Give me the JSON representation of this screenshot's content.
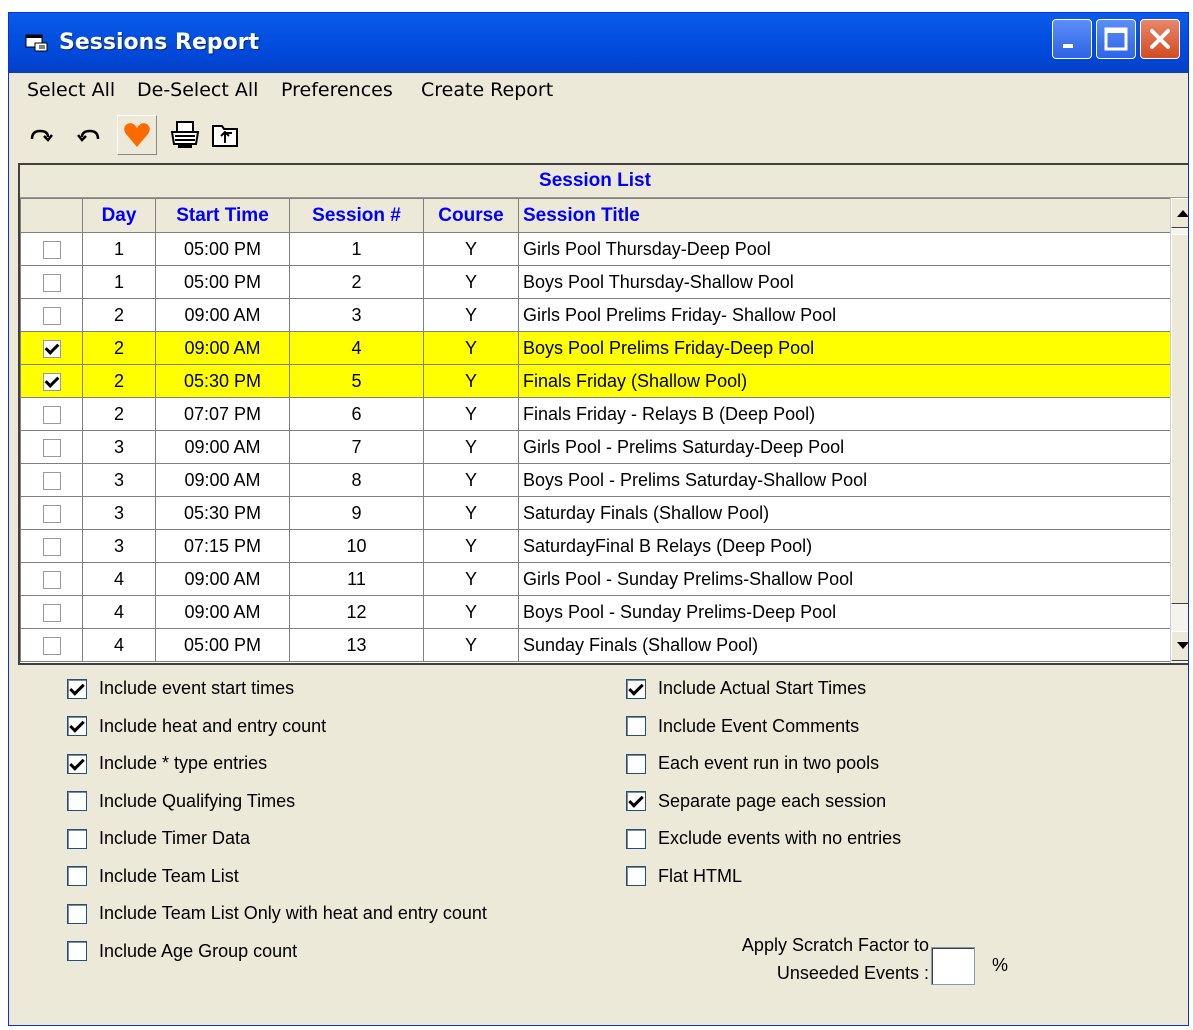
{
  "window": {
    "title": "Sessions Report",
    "title_color": "#FFFFFF",
    "titlebar_color": "#0350E0"
  },
  "menu": [
    "Select All",
    "De-Select All",
    "Preferences",
    "Create Report"
  ],
  "toolbar": {
    "icons": [
      "redo-icon",
      "undo-icon",
      "heart-icon",
      "printer-icon",
      "folder-up-icon"
    ],
    "heart_color": "#FF6A00"
  },
  "grid": {
    "caption": "Session List",
    "columns": [
      "",
      "Day",
      "Start Time",
      "Session #",
      "Course",
      "Session Title"
    ],
    "header_color": "#0000FF",
    "highlight_color": "#FFFF00",
    "rows": [
      {
        "checked": false,
        "day": "1",
        "time": "05:00 PM",
        "session": "1",
        "course": "Y",
        "title": "Girls Pool Thursday-Deep Pool"
      },
      {
        "checked": false,
        "day": "1",
        "time": "05:00 PM",
        "session": "2",
        "course": "Y",
        "title": "Boys Pool Thursday-Shallow Pool"
      },
      {
        "checked": false,
        "day": "2",
        "time": "09:00 AM",
        "session": "3",
        "course": "Y",
        "title": "Girls Pool Prelims Friday- Shallow Pool"
      },
      {
        "checked": true,
        "day": "2",
        "time": "09:00 AM",
        "session": "4",
        "course": "Y",
        "title": "Boys Pool Prelims Friday-Deep Pool"
      },
      {
        "checked": true,
        "day": "2",
        "time": "05:30 PM",
        "session": "5",
        "course": "Y",
        "title": "Finals Friday (Shallow Pool)"
      },
      {
        "checked": false,
        "day": "2",
        "time": "07:07 PM",
        "session": "6",
        "course": "Y",
        "title": "Finals Friday - Relays B (Deep Pool)"
      },
      {
        "checked": false,
        "day": "3",
        "time": "09:00 AM",
        "session": "7",
        "course": "Y",
        "title": "Girls Pool - Prelims Saturday-Deep Pool"
      },
      {
        "checked": false,
        "day": "3",
        "time": "09:00 AM",
        "session": "8",
        "course": "Y",
        "title": "Boys Pool - Prelims Saturday-Shallow Pool"
      },
      {
        "checked": false,
        "day": "3",
        "time": "05:30 PM",
        "session": "9",
        "course": "Y",
        "title": "Saturday Finals (Shallow Pool)"
      },
      {
        "checked": false,
        "day": "3",
        "time": "07:15 PM",
        "session": "10",
        "course": "Y",
        "title": "SaturdayFinal B Relays (Deep Pool)"
      },
      {
        "checked": false,
        "day": "4",
        "time": "09:00 AM",
        "session": "11",
        "course": "Y",
        "title": "Girls Pool - Sunday Prelims-Shallow Pool"
      },
      {
        "checked": false,
        "day": "4",
        "time": "09:00 AM",
        "session": "12",
        "course": "Y",
        "title": "Boys Pool - Sunday Prelims-Deep Pool"
      },
      {
        "checked": false,
        "day": "4",
        "time": "05:00 PM",
        "session": "13",
        "course": "Y",
        "title": "Sunday Finals (Shallow Pool)"
      }
    ]
  },
  "options_left": [
    {
      "label": "Include event start times",
      "checked": true
    },
    {
      "label": "Include heat and entry count",
      "checked": true
    },
    {
      "label": "Include * type entries",
      "checked": true
    },
    {
      "label": "Include Qualifying Times",
      "checked": false
    },
    {
      "label": "Include Timer Data",
      "checked": false
    },
    {
      "label": "Include Team List",
      "checked": false
    },
    {
      "label": "Include Team List Only with heat and entry count",
      "checked": false
    },
    {
      "label": "Include Age Group count",
      "checked": false
    }
  ],
  "options_right": [
    {
      "label": "Include Actual Start Times",
      "checked": true
    },
    {
      "label": "Include Event Comments",
      "checked": false
    },
    {
      "label": "Each event run in two pools",
      "checked": false
    },
    {
      "label": "Separate page each session",
      "checked": true
    },
    {
      "label": "Exclude events with no entries",
      "checked": false
    },
    {
      "label": "Flat HTML",
      "checked": false
    }
  ],
  "scratch": {
    "label_line1": "Apply Scratch Factor to",
    "label_line2": "Unseeded Events :",
    "value": "",
    "unit": "%"
  }
}
